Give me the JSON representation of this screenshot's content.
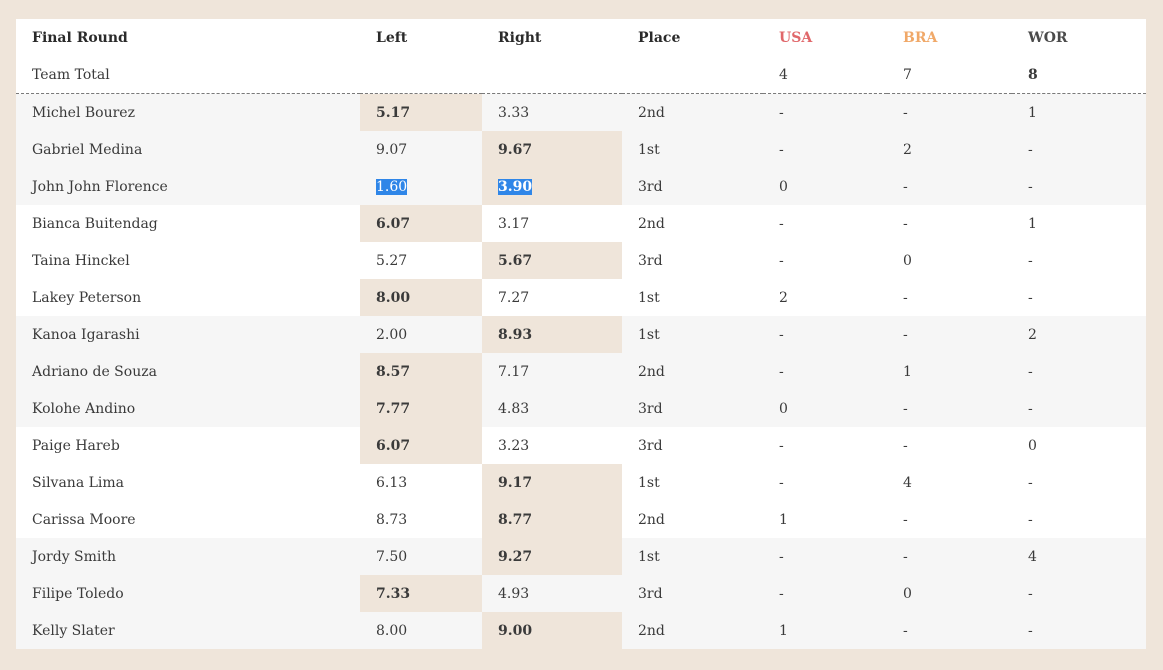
{
  "header": {
    "round": "Final Round",
    "left": "Left",
    "right": "Right",
    "place": "Place",
    "teams": [
      {
        "code": "USA",
        "color": "#e0676a"
      },
      {
        "code": "BRA",
        "color": "#f0a868"
      },
      {
        "code": "WOR",
        "color": "#4a4a4a"
      }
    ]
  },
  "team_total": {
    "label": "Team Total",
    "usa": "4",
    "bra": "7",
    "wor": "8"
  },
  "rows": [
    {
      "name": "Michel Bourez",
      "left": "5.17",
      "right": "3.33",
      "place": "2nd",
      "usa": "-",
      "bra": "-",
      "wor": "1",
      "best": "left",
      "bg": "grey"
    },
    {
      "name": "Gabriel Medina",
      "left": "9.07",
      "right": "9.67",
      "place": "1st",
      "usa": "-",
      "bra": "2",
      "wor": "-",
      "best": "right",
      "bg": "grey"
    },
    {
      "name": "John John Florence",
      "left": "1.60",
      "right": "3.90",
      "place": "3rd",
      "usa": "0",
      "bra": "-",
      "wor": "-",
      "best": "right",
      "bg": "grey",
      "selected": true
    },
    {
      "name": "Bianca Buitendag",
      "left": "6.07",
      "right": "3.17",
      "place": "2nd",
      "usa": "-",
      "bra": "-",
      "wor": "1",
      "best": "left",
      "bg": "white"
    },
    {
      "name": "Taina Hinckel",
      "left": "5.27",
      "right": "5.67",
      "place": "3rd",
      "usa": "-",
      "bra": "0",
      "wor": "-",
      "best": "right",
      "bg": "white"
    },
    {
      "name": "Lakey Peterson",
      "left": "8.00",
      "right": "7.27",
      "place": "1st",
      "usa": "2",
      "bra": "-",
      "wor": "-",
      "best": "left",
      "bg": "white"
    },
    {
      "name": "Kanoa Igarashi",
      "left": "2.00",
      "right": "8.93",
      "place": "1st",
      "usa": "-",
      "bra": "-",
      "wor": "2",
      "best": "right",
      "bg": "grey"
    },
    {
      "name": "Adriano de Souza",
      "left": "8.57",
      "right": "7.17",
      "place": "2nd",
      "usa": "-",
      "bra": "1",
      "wor": "-",
      "best": "left",
      "bg": "grey"
    },
    {
      "name": "Kolohe Andino",
      "left": "7.77",
      "right": "4.83",
      "place": "3rd",
      "usa": "0",
      "bra": "-",
      "wor": "-",
      "best": "left",
      "bg": "grey"
    },
    {
      "name": "Paige Hareb",
      "left": "6.07",
      "right": "3.23",
      "place": "3rd",
      "usa": "-",
      "bra": "-",
      "wor": "0",
      "best": "left",
      "bg": "white"
    },
    {
      "name": "Silvana Lima",
      "left": "6.13",
      "right": "9.17",
      "place": "1st",
      "usa": "-",
      "bra": "4",
      "wor": "-",
      "best": "right",
      "bg": "white"
    },
    {
      "name": "Carissa Moore",
      "left": "8.73",
      "right": "8.77",
      "place": "2nd",
      "usa": "1",
      "bra": "-",
      "wor": "-",
      "best": "right",
      "bg": "white"
    },
    {
      "name": "Jordy Smith",
      "left": "7.50",
      "right": "9.27",
      "place": "1st",
      "usa": "-",
      "bra": "-",
      "wor": "4",
      "best": "right",
      "bg": "grey"
    },
    {
      "name": "Filipe Toledo",
      "left": "7.33",
      "right": "4.93",
      "place": "3rd",
      "usa": "-",
      "bra": "0",
      "wor": "-",
      "best": "left",
      "bg": "grey"
    },
    {
      "name": "Kelly Slater",
      "left": "8.00",
      "right": "9.00",
      "place": "2nd",
      "usa": "1",
      "bra": "-",
      "wor": "-",
      "best": "right",
      "bg": "grey"
    }
  ]
}
